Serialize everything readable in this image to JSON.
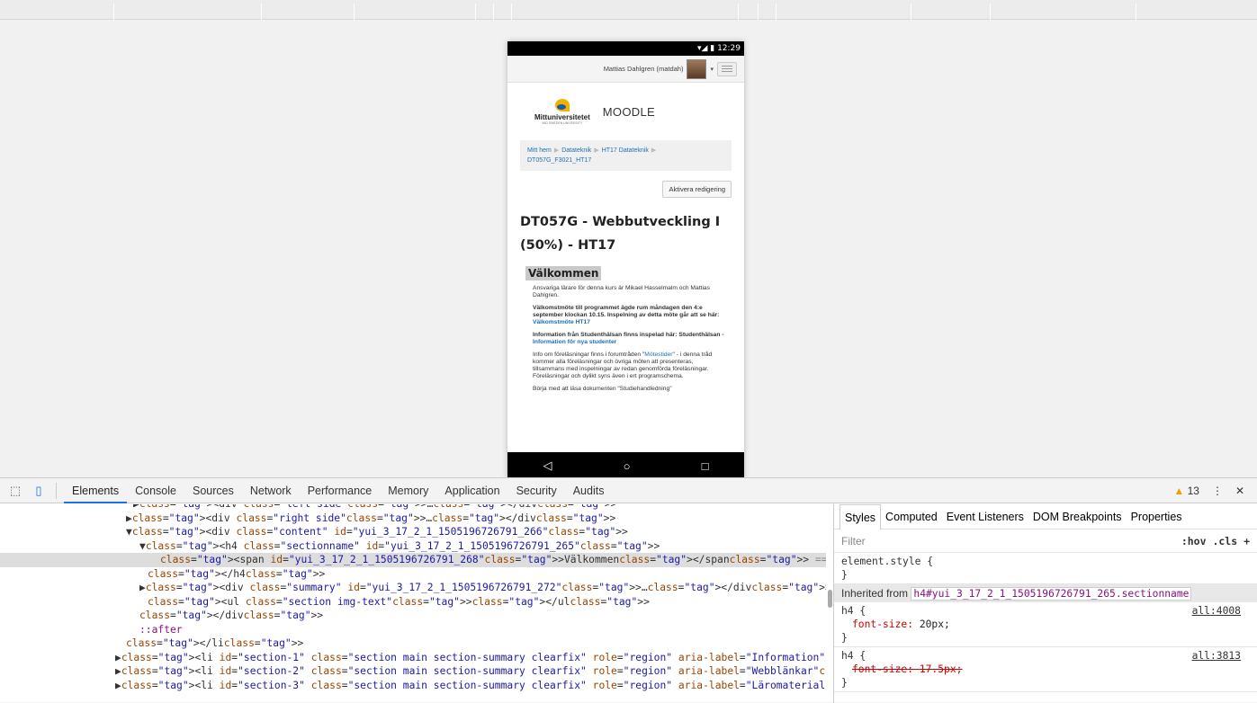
{
  "phone": {
    "status_time": "12:29",
    "user_name": "Mattias Dahlgren (matdah)",
    "logo_text": "Mittuniversitetet",
    "logo_sub": "MID SWEDEN UNIVERSITY",
    "moodle": "MOODLE",
    "breadcrumb": [
      "Mitt hem",
      "Datateknik",
      "HT17 Datateknik",
      "DT057G_F3021_HT17"
    ],
    "edit_button": "Aktivera redigering",
    "course_title": "DT057G - Webbutveckling I (50%) - HT17",
    "section_name": "Välkommen",
    "summary": {
      "p1": "Ansvariga lärare för denna kurs är Mikael Hasselmalm och Mattias Dahlgren.",
      "p2": "Välkomstmöte till programmet ägde rum måndagen den 4:e september klockan 10.15. Inspelning av detta möte går att se här:",
      "p2_link": "Välkomstmöte HT17",
      "p3": "Information från Studenthälsan finns inspelad här: Studenthälsan -",
      "p3_link": "Information för nya studenter",
      "p4a": "Info om föreläsningar finns i forumtråden \"",
      "p4_link": "Mötestider",
      "p4b": "\" - i denna tråd kommer alla föreläsningar och övriga möten att presenteras, tillsammans med inspelningar av redan genomförda föreläsningar. Föreläsningar och dylikt syns även i ert programschema.",
      "p5": "Börja med att läsa dokumenten \"Studiehandledning\""
    },
    "nav": {
      "back": "◁",
      "home": "○",
      "recent": "□"
    }
  },
  "devtools": {
    "tabs": [
      "Elements",
      "Console",
      "Sources",
      "Network",
      "Performance",
      "Memory",
      "Application",
      "Security",
      "Audits"
    ],
    "warnings": "13",
    "styles_tabs": [
      "Styles",
      "Computed",
      "Event Listeners",
      "DOM Breakpoints",
      "Properties"
    ],
    "filter_placeholder": "Filter",
    "filter_tools": ":hov .cls +",
    "element_style": "element.style {",
    "inherited_label": "Inherited from",
    "inherited_selector": "h4#yui_3_17_2_1_1505196726791_265.sectionname",
    "rule1": {
      "selector": "h4 {",
      "src": "all:4008",
      "prop": "font-size",
      "value": "20px;"
    },
    "rule2": {
      "selector": "h4 {",
      "src": "all:3813",
      "prop": "font-size",
      "value": "17.5px;"
    }
  },
  "dom_lines": [
    {
      "indent": 148,
      "html": "▶<div class=\"left side\">…</div>"
    },
    {
      "indent": 140,
      "html": "▶<div class=\"right side\">…</div>"
    },
    {
      "indent": 140,
      "html": "▼<div class=\"content\" id=\"yui_3_17_2_1_1505196726791_266\">"
    },
    {
      "indent": 155,
      "html": "▼<h4 class=\"sectionname\" id=\"yui_3_17_2_1_1505196726791_265\">"
    },
    {
      "indent": 178,
      "html": "<span id=\"yui_3_17_2_1_1505196726791_268\">Välkommen</span> == $0",
      "selected": true
    },
    {
      "indent": 164,
      "html": "</h4>"
    },
    {
      "indent": 155,
      "html": "▶<div class=\"summary\" id=\"yui_3_17_2_1_1505196726791_272\">…</div>"
    },
    {
      "indent": 164,
      "html": "<ul class=\"section img-text\"></ul>"
    },
    {
      "indent": 155,
      "html": "</div>"
    },
    {
      "indent": 155,
      "html": "::after"
    },
    {
      "indent": 140,
      "html": "</li>"
    },
    {
      "indent": 128,
      "html": "▶<li id=\"section-1\" class=\"section main section-summary clearfix\" role=\"region\" aria-label=\"Information\">…</li>"
    },
    {
      "indent": 128,
      "html": "▶<li id=\"section-2\" class=\"section main section-summary clearfix\" role=\"region\" aria-label=\"Webblänkar\">…</li>"
    },
    {
      "indent": 128,
      "html": "▶<li id=\"section-3\" class=\"section main section-summary clearfix\" role=\"region\" aria-label=\"Läromaterial\">…"
    }
  ]
}
